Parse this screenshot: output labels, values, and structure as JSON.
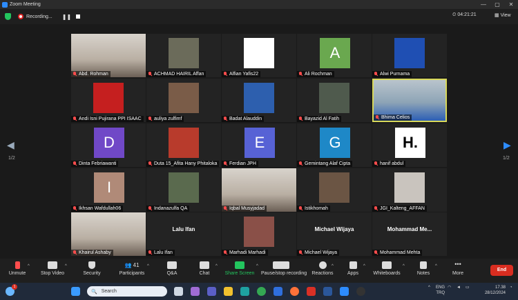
{
  "window": {
    "title": "Zoom Meeting",
    "controls": [
      "—",
      "▢",
      "✕"
    ]
  },
  "recording": {
    "status": "Recording...",
    "timer": "04:21:21",
    "view_label": "View"
  },
  "pagination": {
    "left": "1/2",
    "right": "1/2"
  },
  "participants": [
    {
      "name": "Abd. Rohman",
      "type": "video"
    },
    {
      "name": "ACHMAD HAIRIL Affan",
      "type": "photo",
      "color": "#6b6b5a"
    },
    {
      "name": "Alfian Yafis22",
      "type": "photo",
      "color": "#ffffff"
    },
    {
      "name": "Ali Rochman",
      "type": "letter",
      "letter": "A",
      "color": "#6aa84f"
    },
    {
      "name": "Alwi Purnama",
      "type": "photo",
      "color": "#1f4fb3"
    },
    {
      "name": "Andi Isni Pujirana PPI ISAAC",
      "type": "photo",
      "color": "#c51f1f"
    },
    {
      "name": "auliya zulfimf",
      "type": "photo",
      "color": "#7a5c48"
    },
    {
      "name": "Badat Alauddin",
      "type": "photo",
      "color": "#2d5fae"
    },
    {
      "name": "Bayazid Al Fatih",
      "type": "photo",
      "color": "#4f5a4d"
    },
    {
      "name": "Bhima Celios",
      "type": "video-active"
    },
    {
      "name": "Dinta Febriawanti",
      "type": "letter",
      "letter": "D",
      "color": "#7048c7"
    },
    {
      "name": "Duta 15_Afita Hany Phitaloka",
      "type": "photo",
      "color": "#b83b2c"
    },
    {
      "name": "Ferdian JPH",
      "type": "letter",
      "letter": "E",
      "color": "#5762d5"
    },
    {
      "name": "Gemintang Alaf Cipta",
      "type": "letter",
      "letter": "G",
      "color": "#1e88c7"
    },
    {
      "name": "hanif abdul",
      "type": "letter",
      "letter": "H.",
      "color": "#ffffff",
      "letter_color": "#000000"
    },
    {
      "name": "Ikhsan Wafdullah06",
      "type": "letter",
      "letter": "I",
      "color": "#b08a78"
    },
    {
      "name": "Indanazulfa QA",
      "type": "photo",
      "color": "#5a6a4e"
    },
    {
      "name": "Iqbal Musyjadad",
      "type": "video"
    },
    {
      "name": "Istikhomah",
      "type": "photo",
      "color": "#6b5544"
    },
    {
      "name": "JGI_Kalteng_AFFAN",
      "type": "photo",
      "color": "#c9c4be"
    },
    {
      "name": "Khairul Ashaby",
      "type": "video"
    },
    {
      "name": "Lalu Ifan",
      "type": "text",
      "bigname": "Lalu Ifan"
    },
    {
      "name": "Marhadi Marhadi",
      "type": "photo",
      "color": "#8a5048"
    },
    {
      "name": "Michael Wijaya",
      "type": "text",
      "bigname": "Michael Wijaya"
    },
    {
      "name": "Mohammad Mehta",
      "type": "text",
      "bigname": "Mohammad Me..."
    }
  ],
  "toolbar": {
    "unmute": "Unmute",
    "stop_video": "Stop Video",
    "security": "Security",
    "participants": "Participants",
    "participants_count": "41",
    "qa": "Q&A",
    "chat": "Chat",
    "share_screen": "Share Screen",
    "pause_stop": "Pause/stop recording",
    "reactions": "Reactions",
    "apps": "Apps",
    "whiteboards": "Whiteboards",
    "notes": "Notes",
    "more": "More",
    "end": "End"
  },
  "taskbar": {
    "search_placeholder": "Search",
    "lang": "ENG",
    "region": "TRQ",
    "time": "17.38",
    "date": "28/12/2024",
    "badge": "1"
  }
}
